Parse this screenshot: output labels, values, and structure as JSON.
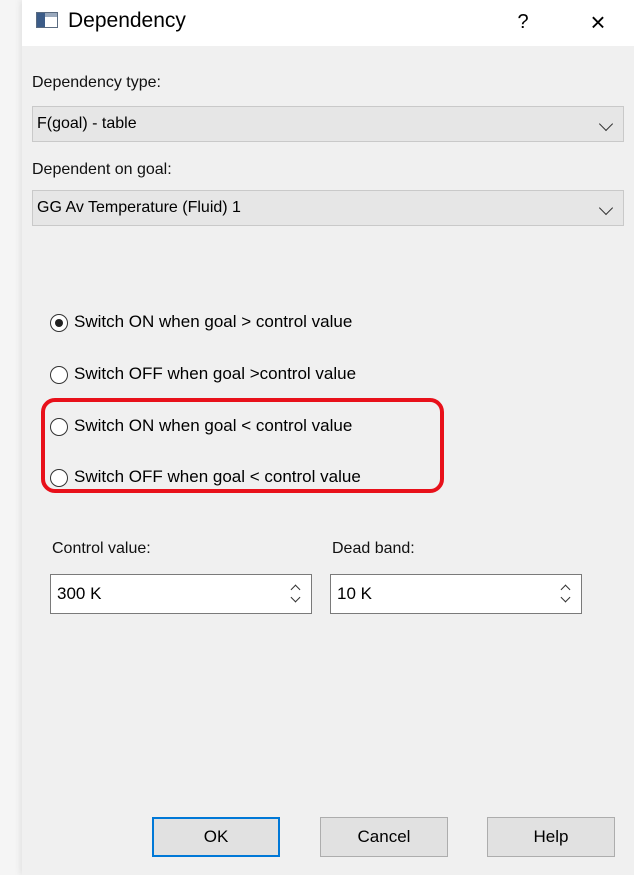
{
  "window": {
    "title": "Dependency",
    "help_label": "?",
    "close_label": "×"
  },
  "dependency_type": {
    "label": "Dependency type:",
    "value": "F(goal) - table"
  },
  "dependent_goal": {
    "label": "Dependent on goal:",
    "value": "GG Av Temperature (Fluid) 1"
  },
  "switch_options": [
    {
      "label": "Switch ON when goal > control value",
      "checked": true
    },
    {
      "label": "Switch OFF when goal >control value",
      "checked": false
    },
    {
      "label": "Switch ON when goal < control value",
      "checked": false
    },
    {
      "label": "Switch OFF when goal < control value",
      "checked": false
    }
  ],
  "highlight_color": "#e8101a",
  "control_value": {
    "label": "Control value:",
    "value": "300 K"
  },
  "dead_band": {
    "label": "Dead band:",
    "value": "10 K"
  },
  "buttons": {
    "ok": "OK",
    "cancel": "Cancel",
    "help": "Help"
  },
  "accent_color": "#0078d7"
}
